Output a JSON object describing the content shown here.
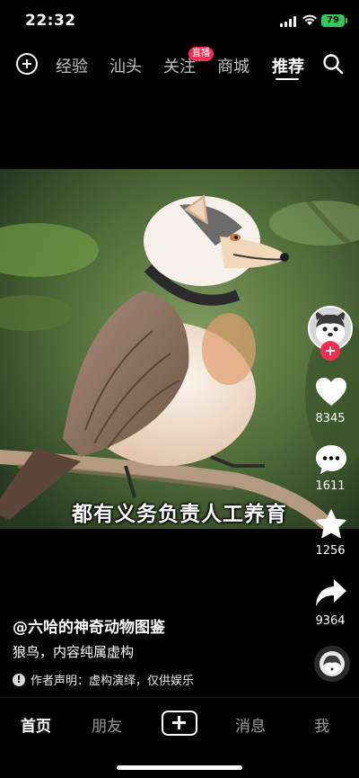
{
  "status_bar": {
    "time": "22:32",
    "battery": "79"
  },
  "top_nav": {
    "tabs": [
      {
        "label": "经验"
      },
      {
        "label": "汕头"
      },
      {
        "label": "关注"
      },
      {
        "label": "商城"
      },
      {
        "label": "推荐",
        "active": true
      }
    ],
    "live_badge": "直播"
  },
  "video": {
    "subtitle": "都有义务负责人工养育"
  },
  "rail": {
    "likes": "8345",
    "comments": "1611",
    "favorites": "1256",
    "shares": "9364"
  },
  "info": {
    "author": "@六哈的神奇动物图鉴",
    "description": "狼鸟，内容纯属虚构",
    "notice": "作者声明：虚构演绎，仅供娱乐"
  },
  "tab_bar": {
    "home": "首页",
    "friends": "朋友",
    "messages": "消息",
    "me": "我"
  },
  "colors": {
    "accent": "#fe2c55",
    "battery": "#35c759"
  }
}
